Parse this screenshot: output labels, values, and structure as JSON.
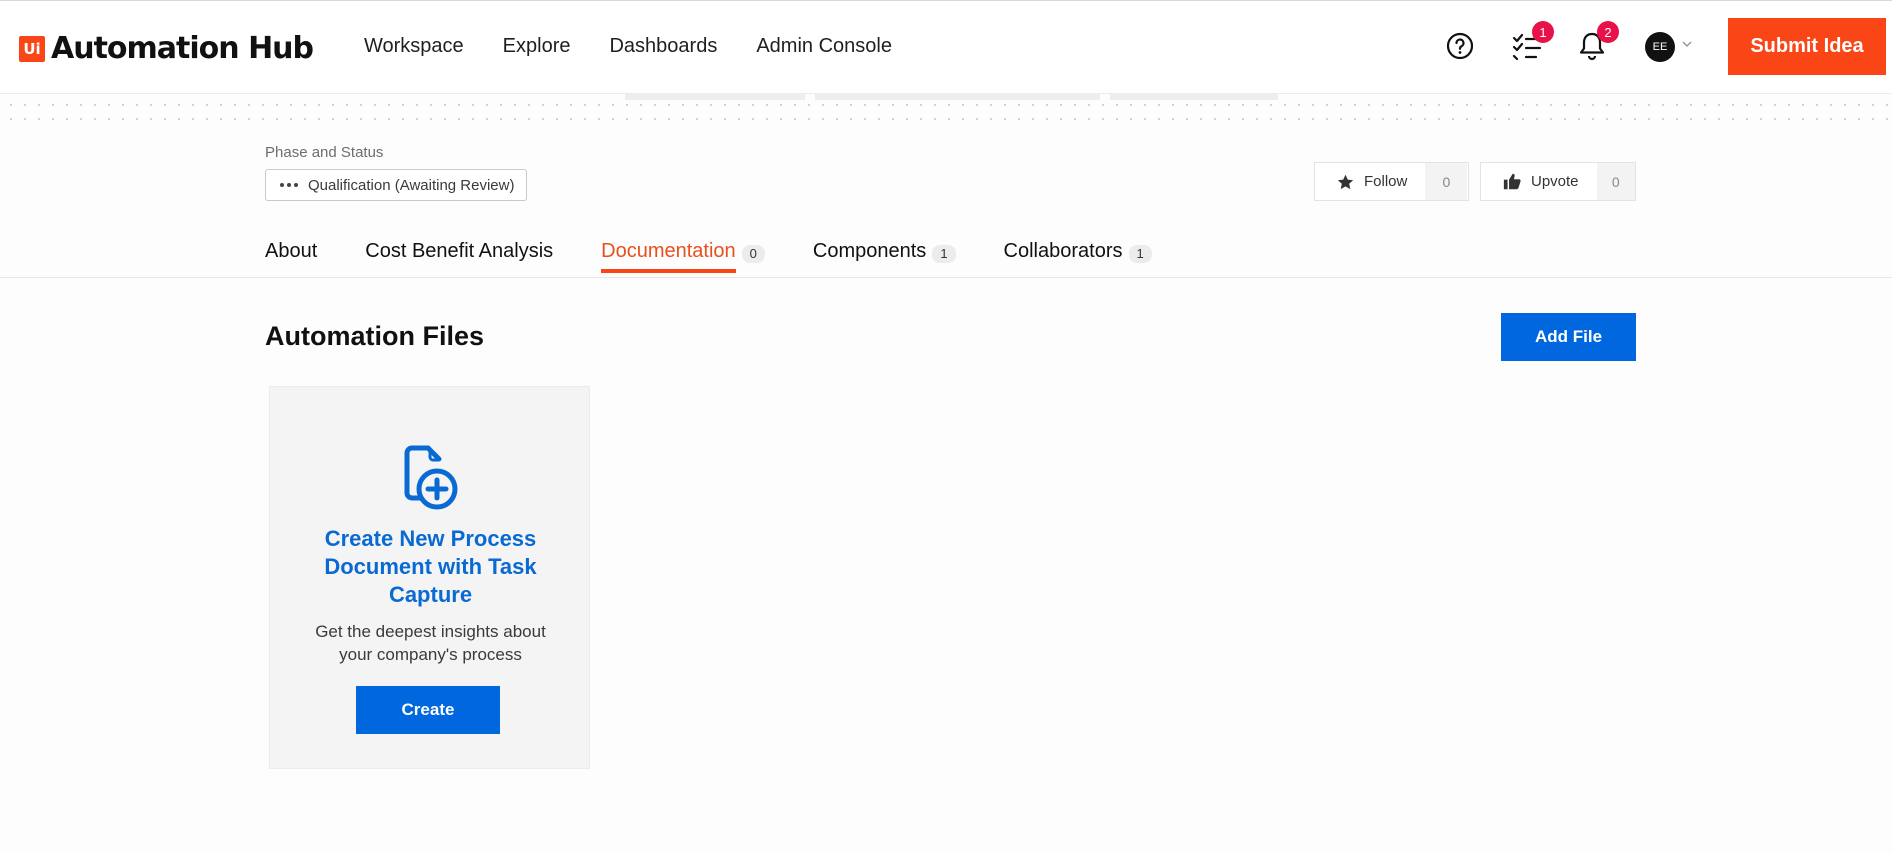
{
  "app": {
    "logo_mark": "Ui",
    "logo_text": "Automation Hub"
  },
  "nav": [
    {
      "label": "Workspace"
    },
    {
      "label": "Explore"
    },
    {
      "label": "Dashboards"
    },
    {
      "label": "Admin Console"
    }
  ],
  "header": {
    "tasks_badge": "1",
    "notifications_badge": "2",
    "avatar_initials": "EE",
    "submit_label": "Submit Idea"
  },
  "phase": {
    "label": "Phase and Status",
    "value": "Qualification (Awaiting Review)"
  },
  "actions": {
    "follow_label": "Follow",
    "follow_count": "0",
    "upvote_label": "Upvote",
    "upvote_count": "0"
  },
  "tabs": [
    {
      "label": "About",
      "count": ""
    },
    {
      "label": "Cost Benefit Analysis",
      "count": ""
    },
    {
      "label": "Documentation",
      "count": "0"
    },
    {
      "label": "Components",
      "count": "1"
    },
    {
      "label": "Collaborators",
      "count": "1"
    }
  ],
  "main": {
    "title": "Automation Files",
    "add_file_label": "Add File",
    "card": {
      "title": "Create New Process Document with Task Capture",
      "description": "Get the deepest insights about your company's process",
      "button_label": "Create"
    }
  },
  "colors": {
    "brand": "#fa4616",
    "primary_button": "#0067df",
    "link": "#0a6ad3",
    "badge": "#e8114a"
  }
}
